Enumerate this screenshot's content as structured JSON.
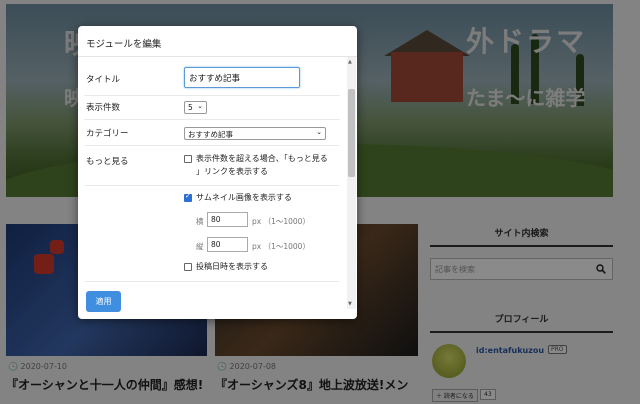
{
  "modal": {
    "title": "モジュールを編集",
    "apply_label": "適用",
    "fields": {
      "title_label": "タイトル",
      "title_value": "おすすめ記事",
      "count_label": "表示件数",
      "count_value": "5",
      "category_label": "カテゴリー",
      "category_value": "おすすめ記事",
      "more_label": "もっと見る",
      "more_text_line1": "表示件数を超える場合、「もっと見る",
      "more_text_line2": "」リンクを表示する",
      "more_checked": false,
      "thumbnail_text": "サムネイル画像を表示する",
      "thumbnail_checked": true,
      "width_label": "横",
      "width_value": "80",
      "width_unit": "px （1〜1000）",
      "height_label": "縦",
      "height_value": "80",
      "height_unit": "px （1〜1000）",
      "date_text": "投稿日時を表示する",
      "date_checked": false
    }
  },
  "background": {
    "hero_left_line1": "映",
    "hero_left_line2": "映",
    "hero_right_line1": "外ドラマ",
    "hero_right_line2": "たま〜に雑学",
    "posts": [
      {
        "date": "2020-07-10",
        "title": "『オーシャンと十一人の仲間』感想!"
      },
      {
        "date": "2020-07-08",
        "title": "『オーシャンズ8』地上波放送!メン"
      }
    ],
    "sidebar": {
      "search_heading": "サイト内検索",
      "search_placeholder": "記事を検索",
      "profile_heading": "プロフィール",
      "profile_id": "id:entafukuzou",
      "profile_badge": "PRO",
      "reader_button": "読者になる",
      "reader_count": "43"
    }
  },
  "colors": {
    "accent": "#3f8ee0",
    "checkbox": "#2d6fd6",
    "focus": "#5a9ad6"
  }
}
